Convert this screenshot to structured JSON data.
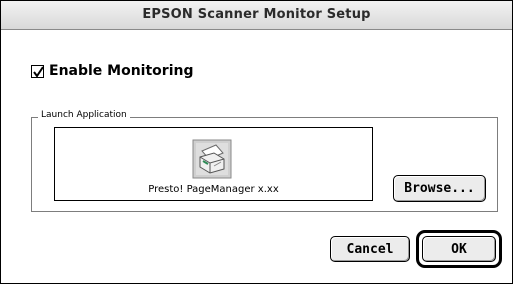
{
  "window": {
    "title": "EPSON Scanner Monitor Setup"
  },
  "monitoring": {
    "checkbox_label": "Enable Monitoring",
    "checked": true
  },
  "launch_application": {
    "group_label": "Launch Application",
    "app_name": "Presto! PageManager x.xx",
    "app_icon": "scanner-app-icon"
  },
  "buttons": {
    "browse": "Browse...",
    "cancel": "Cancel",
    "ok": "OK"
  }
}
